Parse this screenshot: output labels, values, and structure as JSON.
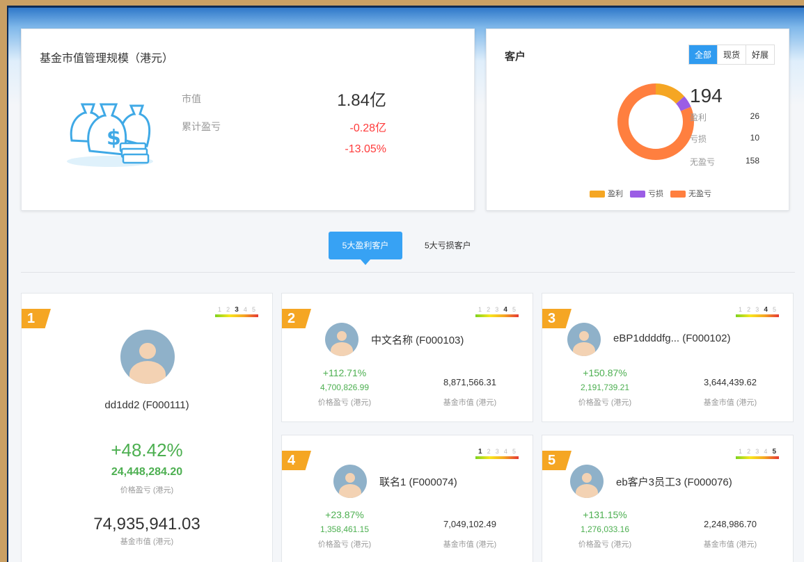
{
  "fund": {
    "title": "基金市值管理规模（港元）",
    "market_value_label": "市值",
    "market_value": "1.84亿",
    "cumulative_pl_label": "累计盈亏",
    "cumulative_pl": "-0.28亿",
    "cumulative_pl_pct": "-13.05%",
    "icon": "money-bags-icon"
  },
  "customers": {
    "title": "客户",
    "filters": [
      "全部",
      "现货",
      "好展"
    ],
    "total": "194",
    "stats": [
      {
        "label": "盈利",
        "value": "26",
        "color": "#f5a623"
      },
      {
        "label": "亏损",
        "value": "10",
        "color": "#9b5de5"
      },
      {
        "label": "无盈亏",
        "value": "158",
        "color": "#ff7f3f"
      }
    ],
    "legend": [
      "盈利",
      "亏损",
      "无盈亏"
    ]
  },
  "tabs": {
    "active": "5大盈利客户",
    "other": "5大亏损客户"
  },
  "ranks": [
    {
      "rank": "1",
      "name": "dd1dd2 (F000111)",
      "pct": "+48.42%",
      "amount": "24,448,284.20",
      "amount_label": "价格盈亏 (港元)",
      "market_value": "74,935,941.03",
      "mv_label": "基金市值 (港元)",
      "scale_level": 3
    },
    {
      "rank": "2",
      "name": "中文名称 (F000103)",
      "pct": "+112.71%",
      "amount": "4,700,826.99",
      "amount_label": "价格盈亏 (港元)",
      "market_value": "8,871,566.31",
      "mv_label": "基金市值 (港元)",
      "scale_level": 4
    },
    {
      "rank": "3",
      "name": "eBP1ddddfg... (F000102)",
      "pct": "+150.87%",
      "amount": "2,191,739.21",
      "amount_label": "价格盈亏 (港元)",
      "market_value": "3,644,439.62",
      "mv_label": "基金市值 (港元)",
      "scale_level": 4
    },
    {
      "rank": "4",
      "name": "联名1 (F000074)",
      "pct": "+23.87%",
      "amount": "1,358,461.15",
      "amount_label": "价格盈亏 (港元)",
      "market_value": "7,049,102.49",
      "mv_label": "基金市值 (港元)",
      "scale_level": 1
    },
    {
      "rank": "5",
      "name": "eb客户3员工3 (F000076)",
      "pct": "+131.15%",
      "amount": "1,276,033.16",
      "amount_label": "价格盈亏 (港元)",
      "market_value": "2,248,986.70",
      "mv_label": "基金市值 (港元)",
      "scale_level": 5
    }
  ],
  "colors": {
    "accent": "#37a2f4",
    "badge": "#f5a623",
    "gain": "#4caf50",
    "loss": "#ff3b3b",
    "donut_main": "#ff7f3f"
  }
}
